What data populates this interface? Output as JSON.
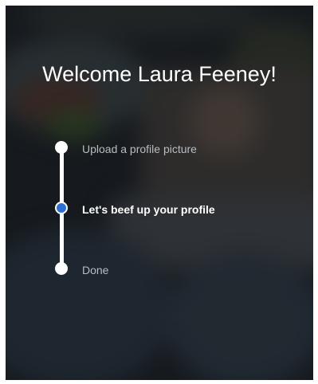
{
  "header": {
    "title": "Welcome Laura Feeney!"
  },
  "steps": [
    {
      "label": "Upload a profile picture",
      "state": "completed"
    },
    {
      "label": "Let's beef up your profile",
      "state": "current"
    },
    {
      "label": "Done",
      "state": "upcoming"
    }
  ],
  "progress": {
    "current_step": 2,
    "total_steps": 3
  },
  "colors": {
    "active_dot": "#2f6fd1",
    "text_active": "#ffffff",
    "text_muted": "#b9bcc0",
    "overlay": "#0a0e12"
  }
}
